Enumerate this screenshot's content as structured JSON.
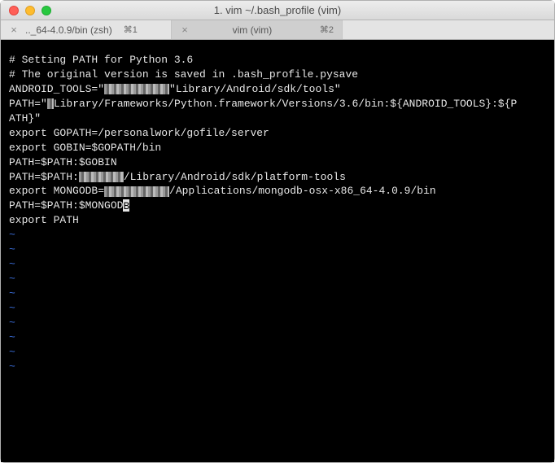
{
  "window": {
    "title": "1. vim ~/.bash_profile (vim)"
  },
  "tabs": [
    {
      "label": ".._64-4.0.9/bin (zsh)",
      "shortcut": "⌘1",
      "active": false
    },
    {
      "label": "vim (vim)",
      "shortcut": "⌘2",
      "active": true
    }
  ],
  "editor": {
    "lines": [
      {
        "type": "text",
        "segments": [
          {
            "t": "# Setting PATH for Python 3.6"
          }
        ]
      },
      {
        "type": "text",
        "segments": [
          {
            "t": "# The original version is saved in .bash_profile.pysave"
          }
        ]
      },
      {
        "type": "text",
        "segments": [
          {
            "t": "ANDROID_TOOLS=\""
          },
          {
            "obf": 80
          },
          {
            "t": "\"Library/Android/sdk/tools\""
          }
        ]
      },
      {
        "type": "text",
        "segments": [
          {
            "t": "PATH=\""
          },
          {
            "obf": 8
          },
          {
            "t": "Library/Frameworks/Python.framework/Versions/3.6/bin:${ANDROID_TOOLS}:${P"
          }
        ]
      },
      {
        "type": "text",
        "segments": [
          {
            "t": "ATH}\""
          }
        ]
      },
      {
        "type": "text",
        "segments": [
          {
            "t": "export GOPATH=/personalwork/gofile/server"
          }
        ]
      },
      {
        "type": "text",
        "segments": [
          {
            "t": "export GOBIN=$GOPATH/bin"
          }
        ]
      },
      {
        "type": "text",
        "segments": [
          {
            "t": "PATH=$PATH:$GOBIN"
          }
        ]
      },
      {
        "type": "text",
        "segments": [
          {
            "t": "PATH=$PATH:"
          },
          {
            "obf": 55
          },
          {
            "t": "/Library/Android/sdk/platform-tools"
          }
        ]
      },
      {
        "type": "text",
        "segments": [
          {
            "t": "export MONGODB="
          },
          {
            "obf": 80
          },
          {
            "t": "/Applications/mongodb-osx-x86_64-4.0.9/bin"
          }
        ]
      },
      {
        "type": "text",
        "segments": [
          {
            "t": "PATH=$PATH:$MONGOD"
          },
          {
            "cursor": "B"
          }
        ]
      },
      {
        "type": "text",
        "segments": [
          {
            "t": "export PATH"
          }
        ]
      },
      {
        "type": "tilde"
      },
      {
        "type": "tilde"
      },
      {
        "type": "tilde"
      },
      {
        "type": "tilde"
      },
      {
        "type": "tilde"
      },
      {
        "type": "tilde"
      },
      {
        "type": "tilde"
      },
      {
        "type": "tilde"
      },
      {
        "type": "tilde"
      },
      {
        "type": "tilde"
      }
    ]
  }
}
